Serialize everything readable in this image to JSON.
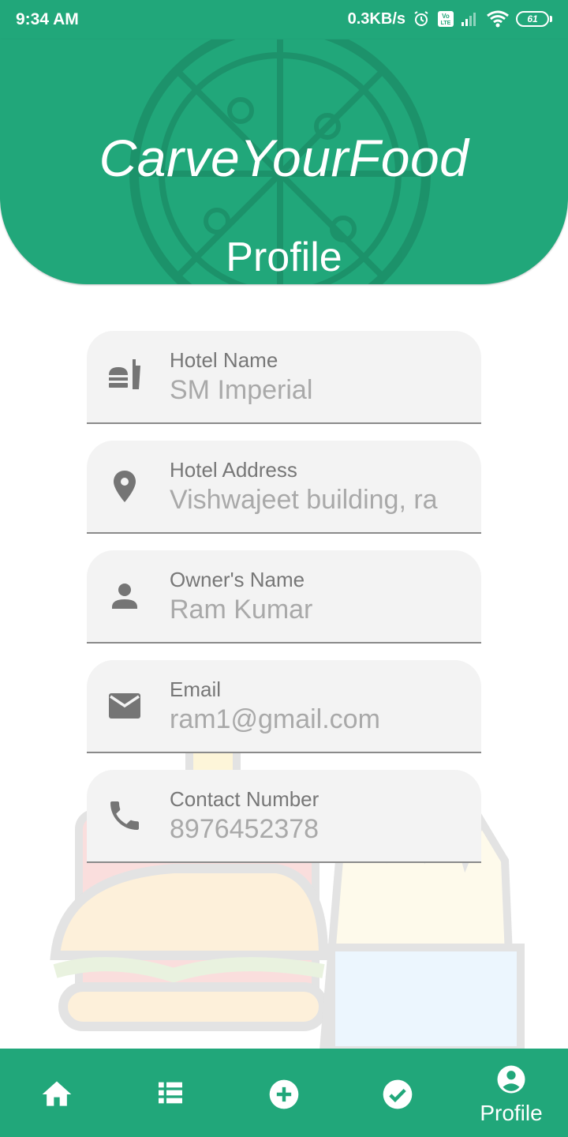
{
  "status_bar": {
    "time": "9:34 AM",
    "network_speed": "0.3KB/s",
    "battery_level": "61",
    "icons": [
      "alarm-icon",
      "volte-icon",
      "signal-icon",
      "wifi-icon",
      "battery-icon"
    ]
  },
  "header": {
    "app_title": "CarveYourFood",
    "page_title": "Profile"
  },
  "form": {
    "hotel_name": {
      "label": "Hotel Name",
      "value": "SM Imperial",
      "icon": "fastfood-icon"
    },
    "hotel_address": {
      "label": "Hotel Address",
      "value": "Vishwajeet building, ra",
      "icon": "location-pin-icon"
    },
    "owner_name": {
      "label": "Owner's Name",
      "value": "Ram Kumar",
      "icon": "person-icon"
    },
    "email": {
      "label": "Email",
      "value": "ram1@gmail.com",
      "icon": "mail-icon"
    },
    "contact_number": {
      "label": "Contact Number",
      "value": "8976452378",
      "icon": "phone-icon"
    }
  },
  "bottom_nav": {
    "items": [
      {
        "icon": "home-icon"
      },
      {
        "icon": "list-icon"
      },
      {
        "icon": "add-circle-icon"
      },
      {
        "icon": "check-circle-icon"
      },
      {
        "icon": "account-circle-icon",
        "label": "Profile",
        "active": true
      }
    ]
  },
  "colors": {
    "primary": "#21a77a",
    "field_background": "#f3f3f3",
    "field_label": "#777777",
    "field_value": "#a9a9a9"
  }
}
